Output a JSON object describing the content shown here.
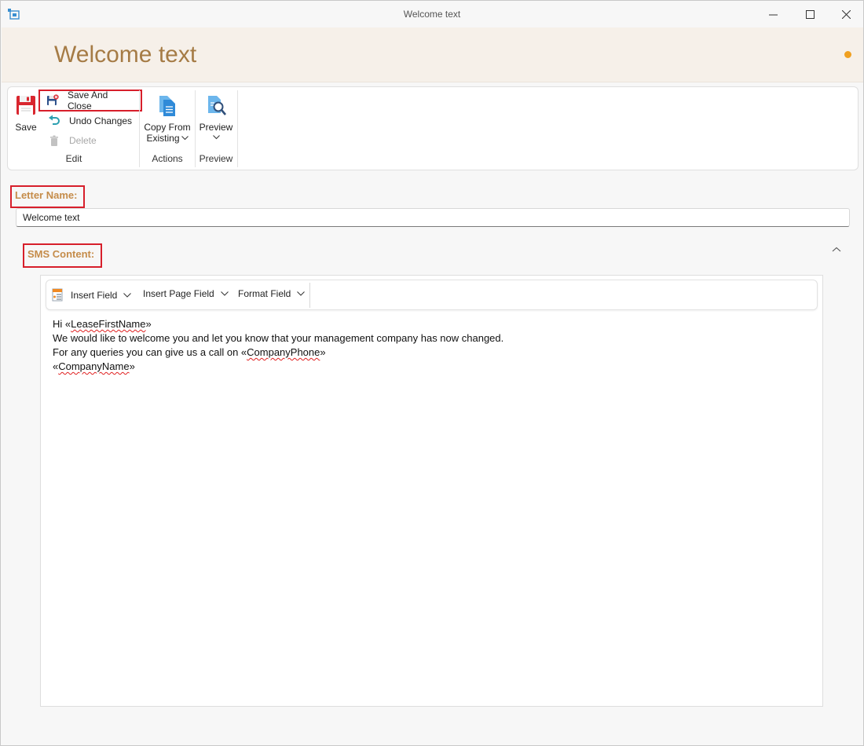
{
  "window": {
    "title": "Welcome text"
  },
  "header": {
    "title": "Welcome text",
    "accent_color": "#a57b45",
    "status_dot_color": "#f0a020"
  },
  "ribbon": {
    "edit_group": {
      "label": "Edit",
      "save": "Save",
      "save_and_close": "Save And Close",
      "undo_changes": "Undo Changes",
      "delete": "Delete"
    },
    "actions_group": {
      "label": "Actions",
      "copy_from_existing_line1": "Copy From",
      "copy_from_existing_line2": "Existing"
    },
    "preview_group": {
      "label": "Preview",
      "preview": "Preview"
    }
  },
  "form": {
    "letter_name_label": "Letter Name:",
    "letter_name_value": "Welcome text",
    "sms_content_label": "SMS Content:"
  },
  "editor": {
    "toolbar": {
      "insert_field": "Insert Field",
      "insert_page_field": "Insert Page Field",
      "format_field": "Format Field"
    },
    "lines": {
      "line1_prefix": "Hi «",
      "line1_field": "LeaseFirstName",
      "line1_suffix": "»",
      "line2": "We would like to welcome you and let you know that your management company has now changed.",
      "line3_prefix": "For any queries you can give us a call on «",
      "line3_field": "CompanyPhone",
      "line3_suffix": "»",
      "line4_prefix": "«",
      "line4_field": "CompanyName",
      "line4_suffix": "»"
    }
  },
  "icons": [
    "app-icon",
    "minimize-icon",
    "maximize-icon",
    "close-icon",
    "save-icon",
    "save-close-icon",
    "undo-icon",
    "trash-icon",
    "copy-document-icon",
    "preview-icon",
    "chevron-down-icon",
    "insert-field-icon",
    "chevron-up-icon"
  ]
}
